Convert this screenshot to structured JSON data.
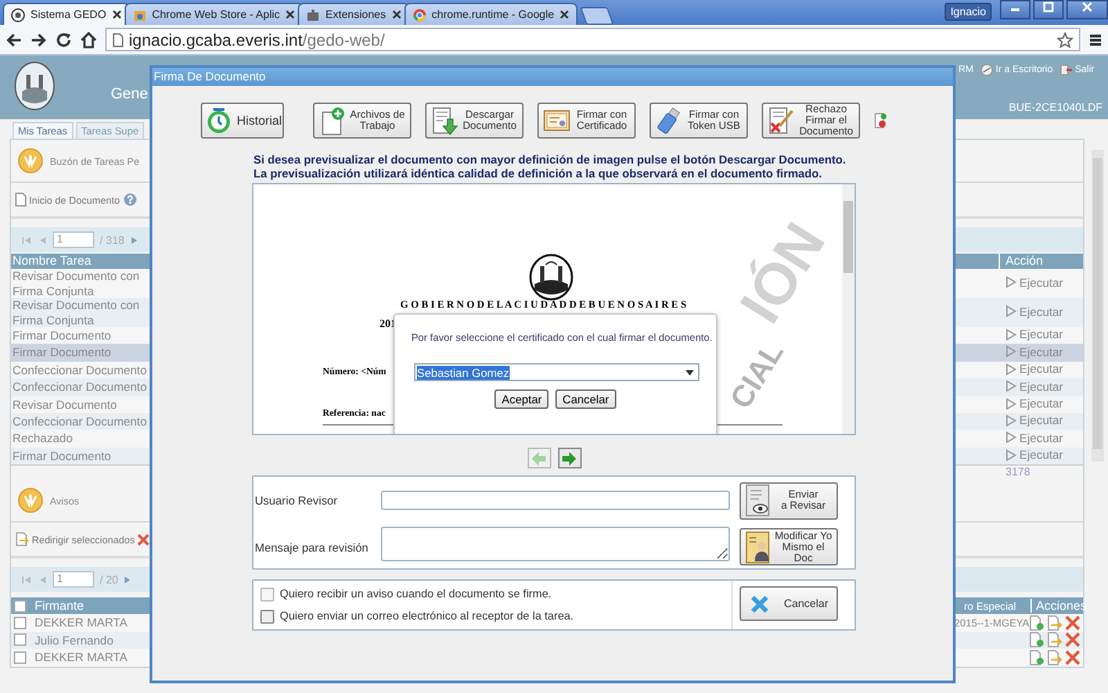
{
  "browser": {
    "tabs": [
      {
        "title": "Sistema GEDO",
        "selected": true
      },
      {
        "title": "Chrome Web Store - Aplic",
        "selected": false
      },
      {
        "title": "Extensiones",
        "selected": false
      },
      {
        "title": "chrome.runtime - Google",
        "selected": false
      }
    ],
    "profile": "Ignacio",
    "url_host": "ignacio.gcaba.everis.int",
    "url_path": "/gedo-web/"
  },
  "app": {
    "title": "Gene",
    "user": "RM",
    "links": [
      "Ir a Escritorio",
      "Salir"
    ],
    "code": "BUE-2CE1040LDF",
    "tabs": [
      {
        "label": "Mis Tareas",
        "selected": true
      },
      {
        "label": "Tareas Supe",
        "selected": false
      }
    ],
    "inbox_title": "Buzón de Tareas Pe",
    "start_label": "Inicio de Documento",
    "pager": {
      "page": "1",
      "total": "/ 318"
    },
    "tasks": {
      "columns": [
        "Nombre Tarea",
        "Acción"
      ],
      "rows": [
        {
          "name": "Revisar Documento con Firma Conjunta",
          "action": "Ejecutar",
          "selected": false
        },
        {
          "name": "Revisar Documento con Firma Conjunta",
          "action": "Ejecutar",
          "selected": false
        },
        {
          "name": "Firmar Documento",
          "action": "Ejecutar",
          "selected": false
        },
        {
          "name": "Firmar Documento",
          "action": "Ejecutar",
          "selected": true
        },
        {
          "name": "Confeccionar Documento",
          "action": "Ejecutar",
          "selected": false
        },
        {
          "name": "Confeccionar Documento",
          "action": "Ejecutar",
          "selected": false
        },
        {
          "name": "Revisar Documento",
          "action": "Ejecutar",
          "selected": false
        },
        {
          "name": "Confeccionar Documento",
          "action": "Ejecutar",
          "selected": false
        },
        {
          "name": "Rechazado",
          "action": "Ejecutar",
          "selected": false
        },
        {
          "name": "Firmar Documento",
          "action": "Ejecutar",
          "selected": false
        }
      ],
      "footer": "3178"
    },
    "notices_title": "Avisos",
    "redirect_label": "Redirigir seleccionados",
    "pager2": {
      "page": "1",
      "total": "/ 20"
    },
    "signers": {
      "all_checked": false,
      "columns": [
        "Firmante",
        "ro Especial",
        "Acciones"
      ],
      "rows": [
        {
          "name": "DEKKER MARTA",
          "special": "2015--1-MGEYA",
          "checked": false
        },
        {
          "name": "Julio Fernando",
          "special": "",
          "checked": false
        },
        {
          "name": "DEKKER MARTA",
          "special": "",
          "checked": false
        }
      ]
    }
  },
  "modal": {
    "title": "Firma De Documento",
    "toolbar": [
      {
        "label": "Historial",
        "kind": "history"
      },
      {
        "label": "Archivos de Trabajo",
        "kind": "files"
      },
      {
        "label": "Descargar Documento",
        "kind": "download"
      },
      {
        "label": "Firmar con Certificado",
        "kind": "certificate"
      },
      {
        "label": "Firmar con Token USB",
        "kind": "usb"
      },
      {
        "label": "Rechazo Firmar el Documento",
        "kind": "reject"
      }
    ],
    "notice": "Si desea previsualizar el documento con mayor definición de imagen pulse el botón Descargar Documento. La previsualización utilizará idéntica calidad de definición a la que observará en el documento firmado.",
    "preview": {
      "heading": "G O B I E R N O D E L A C I U D A D D E B U E N O S A I R E S",
      "year": "201",
      "number": "Número: <Núm",
      "reference": "Referencia: nac",
      "watermark": [
        "IÓN",
        "CIAL"
      ]
    },
    "dialog": {
      "message": "Por favor seleccione el certificado con el cual firmar el documento.",
      "value": "Sebastian Gomez",
      "buttons": [
        "Aceptar",
        "Cancelar"
      ]
    },
    "nav": [
      {
        "kind": "prev",
        "disabled": true
      },
      {
        "kind": "next",
        "disabled": false
      }
    ],
    "fields": [
      {
        "label": "Usuario Revisor",
        "kind": "line",
        "button": "Enviar\na Revisar"
      },
      {
        "label": "Mensaje para revisión",
        "kind": "area",
        "button": "Modificar Yo\nMismo el Doc"
      }
    ],
    "checks": [
      {
        "label": "Quiero recibir un aviso cuando el documento se firme.",
        "checked": false,
        "disabled": true
      },
      {
        "label": "Quiero enviar un correo electrónico al receptor de la tarea.",
        "checked": false,
        "disabled": false
      }
    ],
    "cancel": "Cancelar"
  }
}
